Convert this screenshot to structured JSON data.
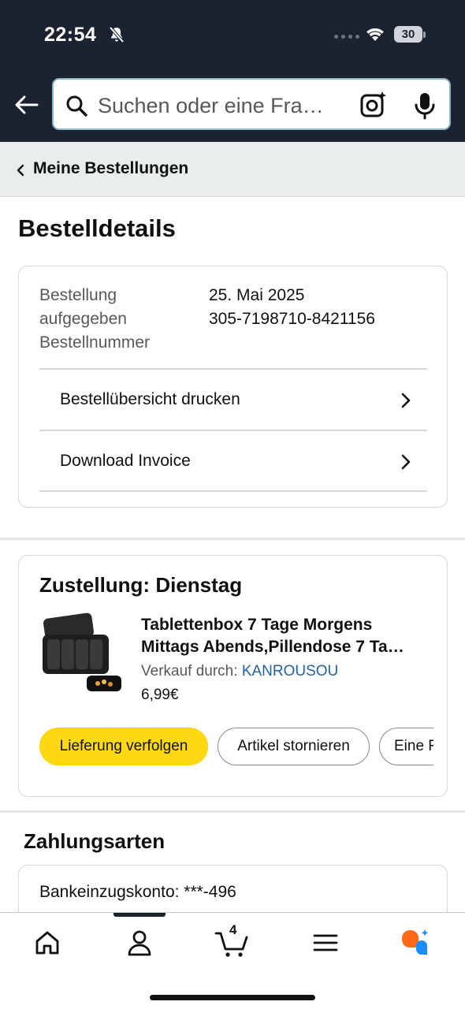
{
  "status_bar": {
    "time": "22:54",
    "battery": "30"
  },
  "search": {
    "placeholder": "Suchen oder eine Fra…"
  },
  "breadcrumb": {
    "label": "Meine Bestellungen"
  },
  "page": {
    "title": "Bestelldetails"
  },
  "order_info": {
    "label_lines": [
      "Bestellung",
      "aufgegeben",
      "Bestellnummer"
    ],
    "date": "25. Mai 2025",
    "order_number": "305-7198710-8421156",
    "links": [
      {
        "label": "Bestellübersicht drucken"
      },
      {
        "label": "Download Invoice"
      }
    ]
  },
  "delivery": {
    "title": "Zustellung: Dienstag",
    "product": {
      "title_line1": "Tablettenbox 7 Tage Morgens",
      "title_line2": "Mittags Abends,Pillendose 7 Ta…",
      "seller_prefix": "Verkauf durch:",
      "seller_name": "KANROUSOU",
      "price": "6,99€"
    },
    "buttons": {
      "track": "Lieferung verfolgen",
      "cancel": "Artikel stornieren",
      "more": "Eine F"
    }
  },
  "payment": {
    "title": "Zahlungsarten",
    "method": "Bankeinzugskonto: ***-496"
  },
  "bottom_nav": {
    "cart_count": "4",
    "items": [
      "home-icon",
      "account-icon",
      "cart-icon",
      "menu-icon",
      "rufus-icon"
    ]
  },
  "colors": {
    "header_bg": "#1b2230",
    "primary_button": "#ffd814",
    "link": "#2162a1",
    "rufus_orange": "#ff6a1a",
    "rufus_blue": "#1a8cff"
  }
}
